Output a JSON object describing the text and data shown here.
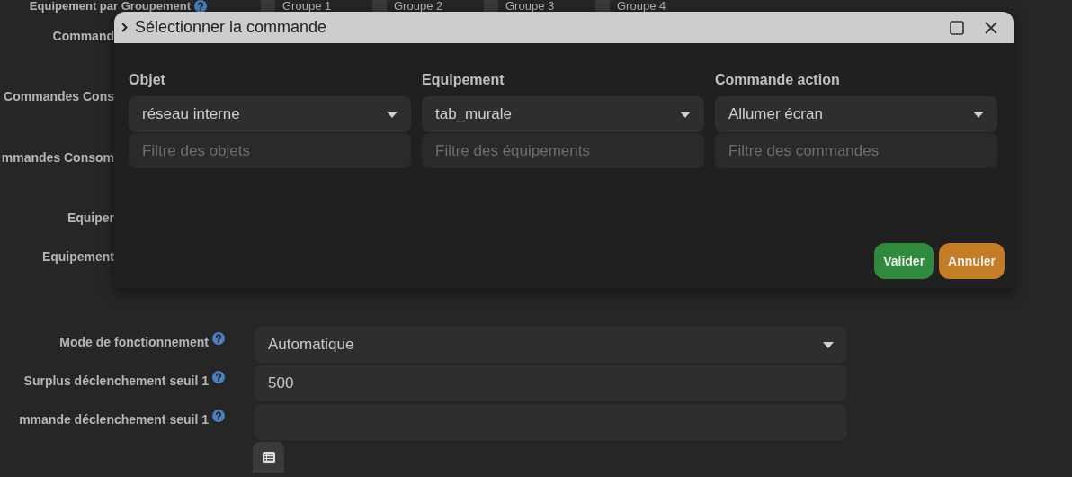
{
  "background_form": {
    "groups_row": {
      "label": "Equipement par Groupement",
      "groups": [
        {
          "label": "Groupe 1",
          "checked": false
        },
        {
          "label": "Groupe 2",
          "checked": false
        },
        {
          "label": "Groupe 3",
          "checked": false
        },
        {
          "label": "Groupe 4",
          "checked": false
        }
      ]
    },
    "covered_labels": [
      "Command",
      "Commandes Cons",
      "mmandes Consom",
      "Equiper",
      "Equipement"
    ],
    "fields": [
      {
        "kind": "select",
        "label": "Mode de fonctionnement",
        "value": "Automatique"
      },
      {
        "kind": "input",
        "label": "Surplus déclenchement seuil 1",
        "value": "500"
      },
      {
        "kind": "input",
        "label": "mmande déclenchement seuil 1"
      }
    ]
  },
  "dialog": {
    "title": "Sélectionner la commande",
    "columns": [
      {
        "heading": "Objet",
        "value": "réseau interne",
        "filter_placeholder": "Filtre des objets"
      },
      {
        "heading": "Equipement",
        "value": "tab_murale",
        "filter_placeholder": "Filtre des équipements"
      },
      {
        "heading": "Commande action",
        "value": "Allumer écran",
        "filter_placeholder": "Filtre des commandes"
      }
    ],
    "buttons": [
      {
        "label": "Valider",
        "kind": "confirm"
      },
      {
        "label": "Annuler",
        "kind": "cancel"
      }
    ]
  }
}
